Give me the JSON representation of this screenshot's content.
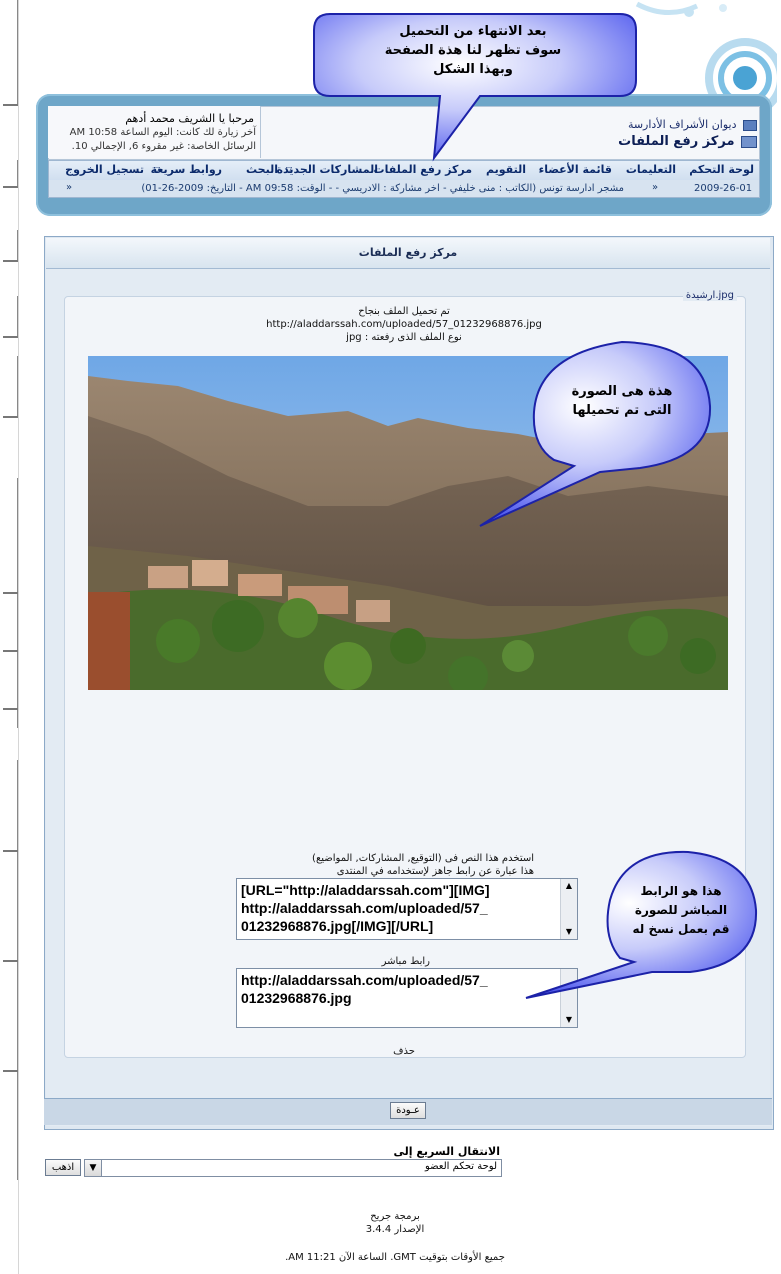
{
  "header": {
    "breadcrumb_root": "ديوان الأشراف الأدارسة",
    "page_title": "مركز رفع الملفات",
    "welcome": "مرحبا يا الشريف محمد أدهم",
    "last_visit": "آخر زيارة لك كانت: اليوم الساعة 10:58 AM",
    "private_messages": "الرسائل الخاصة: غير مقروء 6, الإجمالي 10."
  },
  "nav": {
    "items": [
      "لوحة التحكم",
      "التعليمات",
      "قائمة الأعضاء",
      "التقويم",
      "مركز رفع الملفات",
      "المشاركات الجديدة",
      "البحث",
      "روابط سريعة",
      "تسجيل الخروج"
    ],
    "ticker_date_right": "2009-26-01",
    "ticker_text": "مشجر ادارسة تونس (الكاتب : منى خليفي - آخر مشاركة : الادريسي - - الوقت: 09:58 AM - التاريخ: 2009-26-01)",
    "ticker_arrow": "»"
  },
  "callouts": {
    "top": [
      "بعد الانتهاء من التحميل",
      "سوف تظهر لنا هذة الصفحة",
      "وبهذا الشكل"
    ],
    "image": [
      "هذة هى الصورة",
      "التى تم تحميلها"
    ],
    "link": [
      "هذا هو الرابط",
      "المباشر للصورة",
      "قم بعمل نسخ له"
    ]
  },
  "main": {
    "title": "مركز رفع الملفات",
    "legend": "ارشيدة.jpg",
    "success": "تم تحميل الملف بنجاح",
    "file_url": "http://aladdarssah.com/uploaded/57_01232968876.jpg",
    "file_type": "نوع الملف الذى رفعته : jpg",
    "use_text": "استخدم هذا النص فى (التوقيع, المشاركات, المواضيع)",
    "use_text2": "هذا عبارة عن رابط جاهز لإستخدامه في المنتدى",
    "bbcode": "[URL=\"http://aladdarssah.com\"][IMG]\nhttp://aladdarssah.com/uploaded/57_\n01232968876.jpg[/IMG][/URL]",
    "direct_label": "رابط مباشر",
    "direct_link": "http://aladdarssah.com/uploaded/57_\n01232968876.jpg",
    "delete": "حذف",
    "back_button": "عـودة"
  },
  "jump": {
    "title": "الانتقال السريع إلى",
    "selected": "لوحة تحكم العضو",
    "go_button": "اذهب"
  },
  "footer": {
    "powered": "برمجة جريح",
    "version": "الإصدار 3.4.4",
    "time": "جميع الأوقات بتوقيت GMT. الساعة الآن 11:21 AM."
  },
  "colors": {
    "header_bg": "#6ea6c8",
    "callout_border": "#1c22a8",
    "nav_text": "#0b2a6b"
  }
}
